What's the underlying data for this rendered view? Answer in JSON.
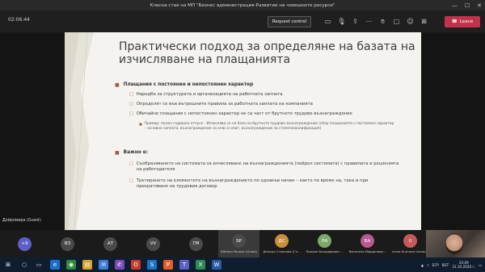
{
  "window": {
    "title": "Класна стая на МП \"Бизнес администрация-Развитие на човешките ресурси\"",
    "controls": [
      "—",
      "☐",
      "✕"
    ]
  },
  "toolbar": {
    "timer": "02:06:44",
    "request_control": "Request control",
    "leave": "Leave",
    "leave_color": "#c4314b"
  },
  "slide": {
    "title": "Практически подход за определяне на базата на изчисляване на плащанията",
    "section1": {
      "heading": "Плащания с постоянен и непостоянен характер",
      "items": [
        "Наредба за структурата и организацията на работната заплата",
        "Определят се във вътрешните правила за работната заплата на компанията",
        "Обичайно плащания с непостоянен характер не са част от брутното трудово възнаграждение"
      ],
      "sub_example": "Пример: пълен годишен отпуск - Изчислява се на база на брутното трудово възнаграждение (сбор плащанията с постоянен характер – основна заплата, възнаграждение за клас и опит, възнаграждение за степен/квалификация)"
    },
    "section2": {
      "heading": "Важно е:",
      "items": [
        "Съобразяването на системата за изчисляване на възнагражденията (пейрол системата) с правилата и решенията на работодателя",
        "Третирането на елементите на възнаграждението по еднакъв начин – както по време на, така и при прекратяване на трудовия договор"
      ]
    }
  },
  "presenter_label": "Дойромира (Guest)",
  "participants": [
    {
      "initials": "+9",
      "name": "",
      "color": "#5b5fc7"
    },
    {
      "initials": "ВЗ",
      "name": "",
      "color": "#4a4a4a"
    },
    {
      "initials": "АТ",
      "name": "",
      "color": "#4a4a4a"
    },
    {
      "initials": "VV",
      "name": "",
      "color": "#4a4a4a"
    },
    {
      "initials": "ГМ",
      "name": "",
      "color": "#4a4a4a"
    },
    {
      "initials": "SP",
      "name": "Stefana Panova (Guest)",
      "color": "#4a4a4a",
      "active": true
    },
    {
      "initials": "ДС",
      "name": "Деница Стоянова (Гл...",
      "color": "#c98f3b"
    },
    {
      "initials": "ЛА",
      "name": "Лилиан Божидарова ...",
      "color": "#7da86a"
    },
    {
      "initials": "ВА",
      "name": "Василена Йорданова...",
      "color": "#b65a8f"
    },
    {
      "initials": "II",
      "name": "Ivana Krumova Ivanova",
      "color": "#c45a5a"
    }
  ],
  "taskbar": {
    "lang": "БГР",
    "time": "10:49",
    "date": "31.10.2020 г.",
    "tray_label": "BGT"
  }
}
